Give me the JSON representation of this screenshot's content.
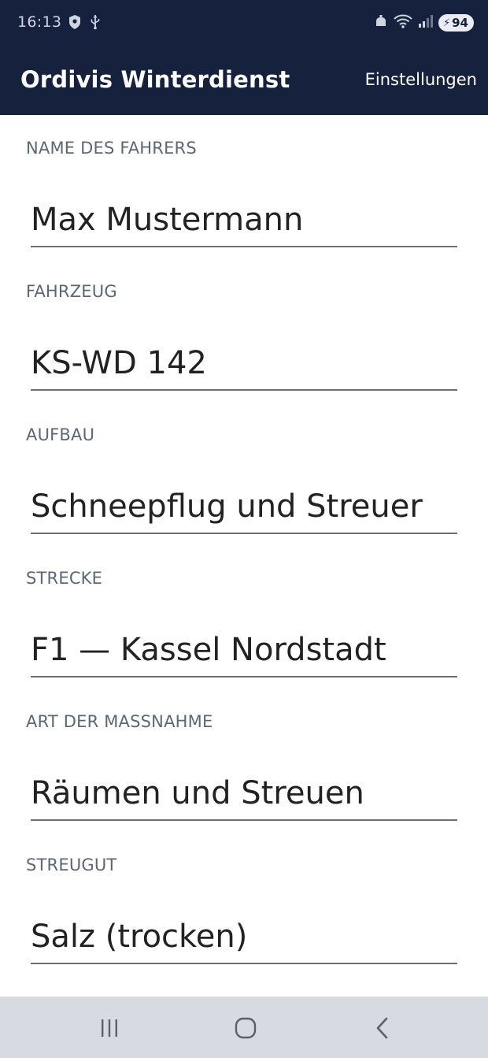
{
  "status_bar": {
    "time": "16:13",
    "battery": "94",
    "icons": [
      "shield-icon",
      "usb-icon",
      "notification-icon",
      "wifi-icon",
      "signal-icon",
      "battery-charging-icon"
    ]
  },
  "app_bar": {
    "title": "Ordivis Winterdienst",
    "settings_label": "Einstellungen"
  },
  "form": {
    "fields": [
      {
        "label": "NAME DES FAHRERS",
        "value": "Max Mustermann"
      },
      {
        "label": "FAHRZEUG",
        "value": "KS-WD 142"
      },
      {
        "label": "AUFBAU",
        "value": "Schneepflug und Streuer"
      },
      {
        "label": "STRECKE",
        "value": "F1 — Kassel Nordstadt"
      },
      {
        "label": "ART DER MASSNAHME",
        "value": "Räumen und Streuen"
      },
      {
        "label": "STREUGUT",
        "value": "Salz (trocken)"
      }
    ]
  },
  "nav_bar": {
    "icons": [
      "recent-apps-icon",
      "home-icon",
      "back-icon"
    ]
  },
  "colors": {
    "header_bg": "#16213d",
    "label": "#5c6678",
    "underline": "#6f6f6f",
    "nav_bg": "#d7dae0"
  }
}
